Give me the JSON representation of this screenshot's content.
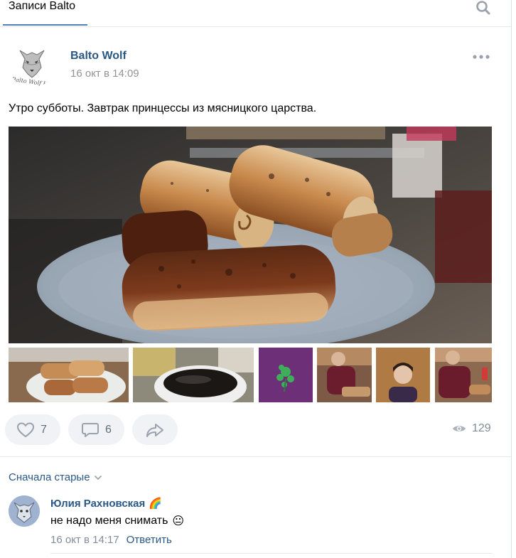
{
  "header": {
    "tab_label": "Записи Balto"
  },
  "post": {
    "author": "Balto Wolf",
    "date": "16 окт в 14:09",
    "text": "Утро субботы. Завтрак принцессы из мясницкого царства.",
    "avatar_caption": "Balto Wolf HD",
    "photos": {
      "main": "grilled-pita-rolls-photo",
      "thumbnails": [
        "rolls-on-plate-photo",
        "cup-of-coffee-photo",
        "green-brooch-photo",
        "person-at-table-photo",
        "person-portrait-photo",
        "person-eating-photo"
      ]
    },
    "likes": "7",
    "comments": "6",
    "views": "129"
  },
  "comments_section": {
    "sort_label": "Сначала старые",
    "comments": [
      {
        "author": "Юлия Рахновская",
        "author_emoji": "🌈",
        "text": "не надо меня снимать",
        "text_emoji": "😐",
        "date": "16 окт в 14:17",
        "reply_label": "Ответить"
      }
    ]
  },
  "colors": {
    "link": "#2a5885",
    "accent": "#5181b8",
    "muted": "#939393",
    "button_bg": "#f0f2f5"
  }
}
